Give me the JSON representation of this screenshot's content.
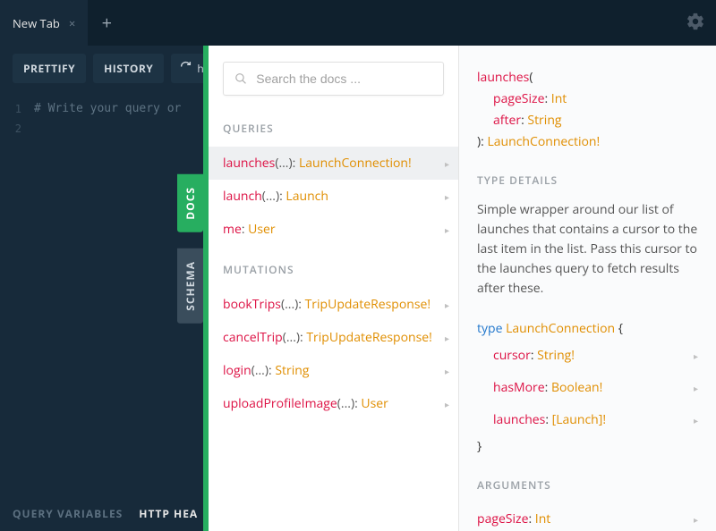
{
  "tabbar": {
    "tab_label": "New Tab",
    "close_x": "×",
    "plus": "+"
  },
  "toolbar": {
    "prettify": "PRETTIFY",
    "history": "HISTORY",
    "url_partial": "ht"
  },
  "editor": {
    "line1_no": "1",
    "line2_no": "2",
    "placeholder": "# Write your query or"
  },
  "footer": {
    "query_variables": "QUERY VARIABLES",
    "http_headers": "HTTP HEA"
  },
  "side_tabs": {
    "docs": "DOCS",
    "schema": "SCHEMA"
  },
  "search": {
    "placeholder": "Search the docs ..."
  },
  "sections": {
    "queries": "QUERIES",
    "mutations": "MUTATIONS",
    "type_details": "TYPE DETAILS",
    "arguments": "ARGUMENTS"
  },
  "queries": [
    {
      "name": "launches",
      "args": "(...)",
      "ret": "LaunchConnection!",
      "selected": true
    },
    {
      "name": "launch",
      "args": "(...)",
      "ret": "Launch"
    },
    {
      "name": "me",
      "args": "",
      "ret": "User"
    }
  ],
  "mutations": [
    {
      "name": "bookTrips",
      "args": "(...)",
      "ret": "TripUpdateResponse!"
    },
    {
      "name": "cancelTrip",
      "args": "(...)",
      "ret": "TripUpdateResponse!"
    },
    {
      "name": "login",
      "args": "(...)",
      "ret": "String"
    },
    {
      "name": "uploadProfileImage",
      "args": "(...)",
      "ret": "User"
    }
  ],
  "signature": {
    "name": "launches",
    "open": "(",
    "args": [
      {
        "name": "pageSize",
        "type": "Int"
      },
      {
        "name": "after",
        "type": "String"
      }
    ],
    "close": "): ",
    "ret": "LaunchConnection!"
  },
  "description": "Simple wrapper around our list of launches that contains a cursor to the last item in the list. Pass this cursor to the launches query to fetch results after these.",
  "type_def": {
    "keyword": "type",
    "name": "LaunchConnection",
    "open": " {",
    "close": "}",
    "fields": [
      {
        "name": "cursor",
        "type": "String!"
      },
      {
        "name": "hasMore",
        "type": "Boolean!"
      },
      {
        "name": "launches",
        "type": "[Launch]!"
      }
    ]
  },
  "arguments_list": [
    {
      "name": "pageSize",
      "type": "Int"
    }
  ],
  "glyphs": {
    "chevron": "▸",
    "colon": ": "
  }
}
